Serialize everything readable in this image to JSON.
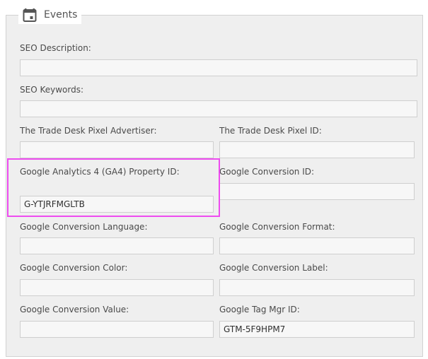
{
  "section": {
    "title": "Events",
    "icon": "calendar-icon"
  },
  "fields": {
    "seo_description": {
      "label": "SEO Description:",
      "value": ""
    },
    "seo_keywords": {
      "label": "SEO Keywords:",
      "value": ""
    },
    "ttd_advertiser": {
      "label": "The Trade Desk Pixel Advertiser:",
      "value": ""
    },
    "ttd_pixel_id": {
      "label": "The Trade Desk Pixel ID:",
      "value": ""
    },
    "ga4_property_id": {
      "label": "Google Analytics 4 (GA4) Property ID:",
      "value": "G-YTJRFMGLTB"
    },
    "google_conversion_id": {
      "label": "Google Conversion ID:",
      "value": ""
    },
    "google_conversion_language": {
      "label": "Google Conversion Language:",
      "value": ""
    },
    "google_conversion_format": {
      "label": "Google Conversion Format:",
      "value": ""
    },
    "google_conversion_color": {
      "label": "Google Conversion Color:",
      "value": ""
    },
    "google_conversion_label": {
      "label": "Google Conversion Label:",
      "value": ""
    },
    "google_conversion_value": {
      "label": "Google Conversion Value:",
      "value": ""
    },
    "google_tag_mgr_id": {
      "label": "Google Tag Mgr ID:",
      "value": "GTM-5F9HPM7"
    }
  },
  "colors": {
    "highlight": "#ee4cf0",
    "panel_bg": "#efefef",
    "field_bg": "#f7f7f7"
  }
}
